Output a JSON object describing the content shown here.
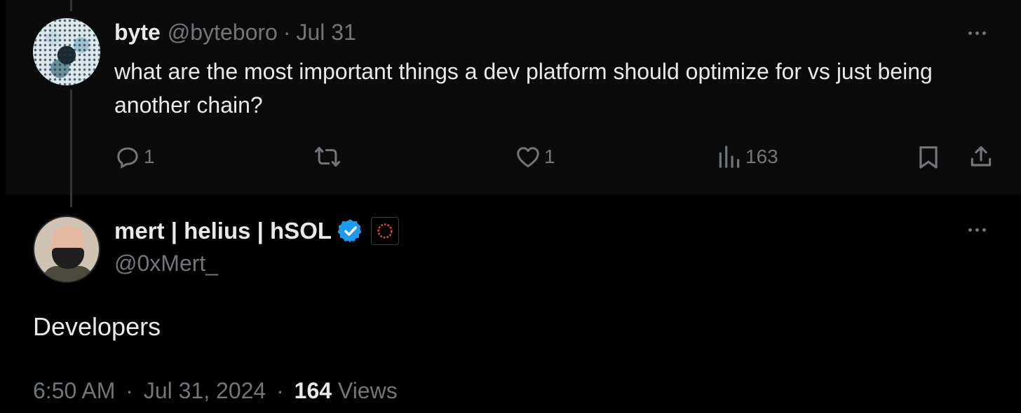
{
  "parent_tweet": {
    "author_name": "byte",
    "handle": "@byteboro",
    "separator": "·",
    "date": "Jul 31",
    "text": "what are the most important things a dev platform should optimize for vs just being another chain?",
    "replies": "1",
    "likes": "1",
    "views": "163",
    "icons": [
      "reply-icon",
      "retweet-icon",
      "like-icon",
      "views-icon",
      "bookmark-icon",
      "share-icon"
    ]
  },
  "main_tweet": {
    "author_name": "mert | helius | hSOL",
    "handle": "@0xMert_",
    "text": "Developers",
    "time": "6:50 AM",
    "separator": "·",
    "date": "Jul 31, 2024",
    "views_count": "164",
    "views_label": "Views",
    "verified_color": "#1d9bf0",
    "affiliate_color": "#e8452c"
  },
  "theme": {
    "background": "#000000",
    "parent_background": "#0b0b0b",
    "text": "#e7e9ea",
    "muted": "#71767b"
  }
}
